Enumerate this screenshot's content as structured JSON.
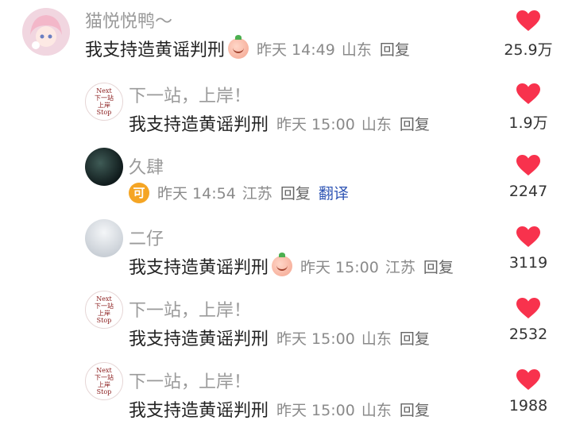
{
  "colors": {
    "heart": "#f8324d",
    "translate": "#2f55b4",
    "coin": "#f5a524"
  },
  "station_avatar": {
    "line1": "Next",
    "line2": "下一站",
    "line3": "上岸",
    "line4": "Stop"
  },
  "comments": [
    {
      "username": "猫悦悦鸭～",
      "text": "我支持造黄谣判刑",
      "time": "昨天 14:49",
      "location": "山东",
      "reply": "回复",
      "likes": "25.9万",
      "has_emoji": true
    },
    {
      "username": "下一站，上岸！",
      "text": "我支持造黄谣判刑",
      "time": "昨天 15:00",
      "location": "山东",
      "reply": "回复",
      "likes": "1.9万"
    },
    {
      "username": "久肆",
      "badge": "可",
      "time": "昨天 14:54",
      "location": "江苏",
      "reply": "回复",
      "translate": "翻译",
      "likes": "2247"
    },
    {
      "username": "二仔",
      "text": "我支持造黄谣判刑",
      "time": "昨天 15:00",
      "location": "江苏",
      "reply": "回复",
      "likes": "3119",
      "has_emoji": true
    },
    {
      "username": "下一站，上岸！",
      "text": "我支持造黄谣判刑",
      "time": "昨天 15:00",
      "location": "山东",
      "reply": "回复",
      "likes": "2532"
    },
    {
      "username": "下一站，上岸！",
      "text": "我支持造黄谣判刑",
      "time": "昨天 15:00",
      "location": "山东",
      "reply": "回复",
      "likes": "1988"
    }
  ]
}
